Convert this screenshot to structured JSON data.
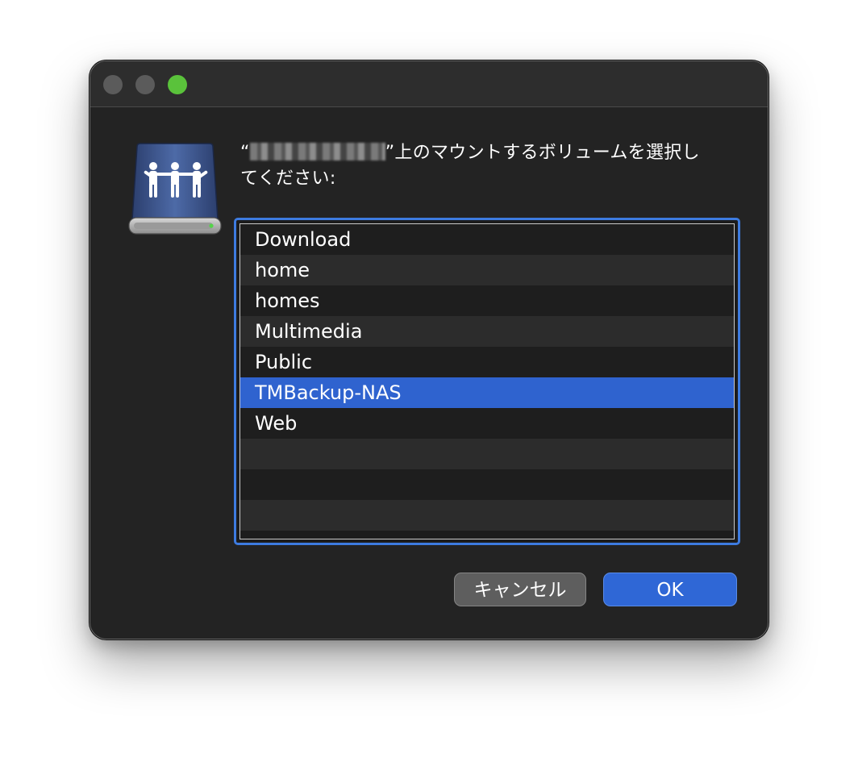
{
  "dialog": {
    "prompt_open_quote": "“",
    "prompt_host_redacted": "",
    "prompt_line1_rest": "”上のマウントするボリュームを選択し",
    "prompt_line2": "てください:",
    "volume_icon": "shared-server-volume-icon"
  },
  "volumes": [
    {
      "label": "Download",
      "selected": false
    },
    {
      "label": "home",
      "selected": false
    },
    {
      "label": "homes",
      "selected": false
    },
    {
      "label": "Multimedia",
      "selected": false
    },
    {
      "label": "Public",
      "selected": false
    },
    {
      "label": "TMBackup-NAS",
      "selected": true
    },
    {
      "label": "Web",
      "selected": false
    }
  ],
  "buttons": {
    "cancel_label": "キャンセル",
    "ok_label": "OK"
  },
  "colors": {
    "accent": "#2f63cf",
    "window_bg": "#232323",
    "zoom_button": "#5ac23b"
  }
}
